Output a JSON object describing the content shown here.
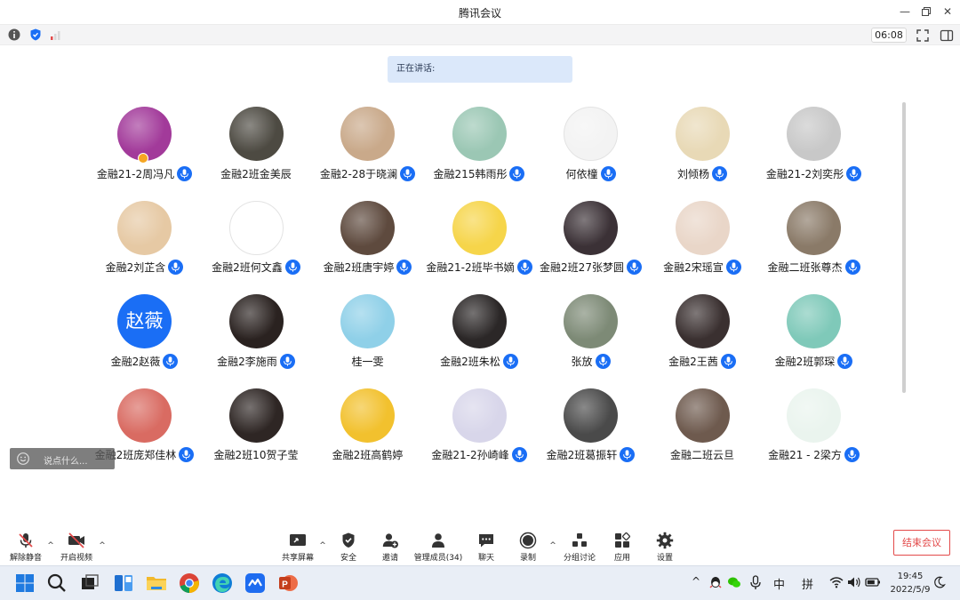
{
  "window": {
    "title": "腾讯会议",
    "minimize_icon": "minimize-icon",
    "restore_icon": "restore-icon",
    "close_icon": "close-icon"
  },
  "infobar": {
    "timer": "06:08",
    "icons": [
      "info-icon",
      "shield-icon",
      "signal-icon",
      "fullscreen-icon",
      "sidebar-toggle-icon"
    ]
  },
  "speaking": {
    "label": "正在讲话:"
  },
  "participants": [
    {
      "name": "金融21-2周冯凡",
      "avatar": "photo",
      "color": "#a23a9a",
      "mic": true,
      "badge": true
    },
    {
      "name": "金融2班金美辰",
      "avatar": "photo",
      "color": "#4d4a42",
      "mic": false
    },
    {
      "name": "金融2-28于晓澜",
      "avatar": "photo",
      "color": "#c9a98a",
      "mic": true
    },
    {
      "name": "金融215韩雨彤",
      "avatar": "photo",
      "color": "#9bc7b4",
      "mic": true
    },
    {
      "name": "何依橦",
      "avatar": "photo",
      "color": "#f3f3f3",
      "mic": true
    },
    {
      "name": "刘倾杨",
      "avatar": "photo",
      "color": "#e8d9b6",
      "mic": true
    },
    {
      "name": "金融21-2刘奕彤",
      "avatar": "photo",
      "color": "#c8c8c8",
      "mic": true
    },
    {
      "name": "金融2刘芷含",
      "avatar": "photo",
      "color": "#e6c9a4",
      "mic": true
    },
    {
      "name": "金融2班何文鑫",
      "avatar": "photo",
      "color": "#ffffff",
      "mic": true
    },
    {
      "name": "金融2班唐宇婷",
      "avatar": "photo",
      "color": "#5e4a3e",
      "mic": true
    },
    {
      "name": "金融21-2班毕书嫡",
      "avatar": "photo",
      "color": "#f6d54a",
      "mic": true
    },
    {
      "name": "金融2班27张梦圆",
      "avatar": "photo",
      "color": "#3b3136",
      "mic": true
    },
    {
      "name": "金融2宋瑶宣",
      "avatar": "photo",
      "color": "#e9d6c8",
      "mic": true
    },
    {
      "name": "金融二班张尊杰",
      "avatar": "photo",
      "color": "#8a7a68",
      "mic": true
    },
    {
      "name": "金融2赵薇",
      "avatar": "text",
      "text": "赵薇",
      "color": "#1a6ef5",
      "mic": true
    },
    {
      "name": "金融2李施雨",
      "avatar": "photo",
      "color": "#2a2220",
      "mic": true
    },
    {
      "name": "桂一雯",
      "avatar": "photo",
      "color": "#8fd0e8",
      "mic": false
    },
    {
      "name": "金融2班朱松",
      "avatar": "photo",
      "color": "#2b2727",
      "mic": true
    },
    {
      "name": "张放",
      "avatar": "photo",
      "color": "#7d8a76",
      "mic": true
    },
    {
      "name": "金融2王茜",
      "avatar": "photo",
      "color": "#3a3030",
      "mic": true
    },
    {
      "name": "金融2班郭琛",
      "avatar": "photo",
      "color": "#7fc9b9",
      "mic": true
    },
    {
      "name": "金融2班庞郑佳林",
      "avatar": "photo",
      "color": "#d96b62",
      "mic": true
    },
    {
      "name": "金融2班10贺子莹",
      "avatar": "photo",
      "color": "#2e2624",
      "mic": false
    },
    {
      "name": "金融2班高鹤婷",
      "avatar": "photo",
      "color": "#f2c12e",
      "mic": false
    },
    {
      "name": "金融21-2孙崎峰",
      "avatar": "photo",
      "color": "#d8d6ea",
      "mic": true
    },
    {
      "name": "金融2班葛振轩",
      "avatar": "photo",
      "color": "#4a4a4a",
      "mic": true
    },
    {
      "name": "金融二班云旦",
      "avatar": "photo",
      "color": "#6e5a4e",
      "mic": false
    },
    {
      "name": "金融21 - 2梁方",
      "avatar": "photo",
      "color": "#eaf4ee",
      "mic": true
    }
  ],
  "chat": {
    "placeholder": "说点什么..."
  },
  "toolbar": {
    "unmute": "解除静音",
    "start_video": "开启视频",
    "share": "共享屏幕",
    "security": "安全",
    "invite": "邀请",
    "members": "管理成员(34)",
    "chat": "聊天",
    "record": "录制",
    "breakout": "分组讨论",
    "apps": "应用",
    "settings": "设置",
    "end": "结束会议"
  },
  "taskbar": {
    "ime_lang": "中",
    "ime_mode": "拼",
    "time": "19:45",
    "date": "2022/5/9"
  },
  "colors": {
    "accent": "#1a6ef5",
    "danger": "#e34a4a",
    "speaking_bg": "#dbe8fa"
  }
}
